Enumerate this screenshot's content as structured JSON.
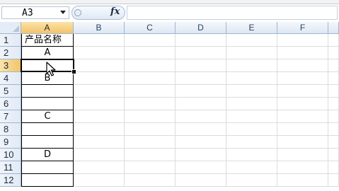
{
  "formula_bar": {
    "name_box": "A3",
    "fx_label": "fx",
    "formula": ""
  },
  "columns": [
    "A",
    "B",
    "C",
    "D",
    "E",
    "F"
  ],
  "rows": [
    "1",
    "2",
    "3",
    "4",
    "5",
    "6",
    "7",
    "8",
    "9",
    "10",
    "11",
    "12"
  ],
  "cells": {
    "A1": "产品名称",
    "A2": "A",
    "A3": "",
    "A4": "B",
    "A5": "",
    "A6": "",
    "A7": "C",
    "A8": "",
    "A9": "",
    "A10": "D",
    "A11": "",
    "A12": ""
  },
  "selection": {
    "active_cell": "A3"
  },
  "colors": {
    "header_active": "#f3c46a",
    "gridline": "#dadcdd",
    "header_border": "#9eb6ce"
  }
}
